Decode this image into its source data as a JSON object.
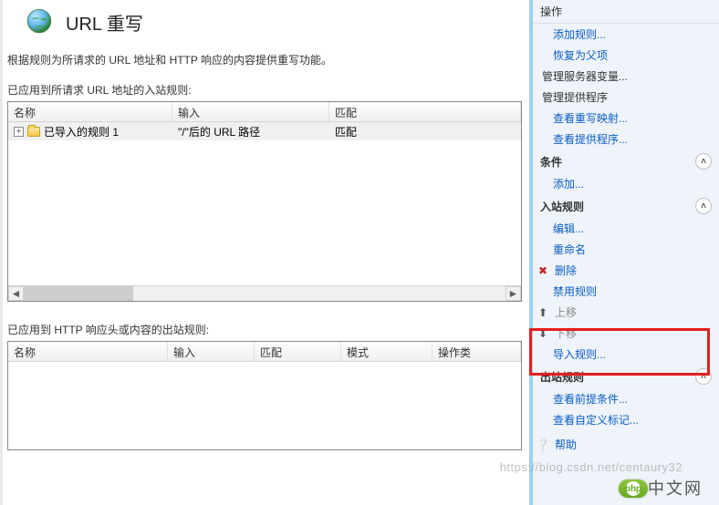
{
  "header": {
    "title": "URL 重写"
  },
  "description": "根据规则为所请求的 URL 地址和 HTTP 响应的内容提供重写功能。",
  "inbound": {
    "label": "已应用到所请求 URL 地址的入站规则:",
    "columns": {
      "name": "名称",
      "input": "输入",
      "match": "匹配"
    },
    "rows": [
      {
        "name": "已导入的规则 1",
        "input": "\"/\"后的 URL 路径",
        "match": "匹配"
      }
    ]
  },
  "outbound": {
    "label": "已应用到 HTTP 响应头或内容的出站规则:",
    "columns": {
      "name": "名称",
      "input": "输入",
      "match": "匹配",
      "mode": "模式",
      "optype": "操作类"
    }
  },
  "sidebar": {
    "title": "操作",
    "actions": {
      "add_rule": "添加规则...",
      "revert_parent": "恢复为父项",
      "manage_server_vars": "管理服务器变量...",
      "manage_providers": "管理提供程序",
      "view_rewrite_maps": "查看重写映射...",
      "view_providers": "查看提供程序..."
    },
    "conditions": {
      "head": "条件",
      "add": "添加..."
    },
    "inbound_rules": {
      "head": "入站规则",
      "edit": "编辑...",
      "rename": "重命名",
      "delete": "删除",
      "disable": "禁用规则",
      "move_up": "上移",
      "move_down": "下移",
      "import": "导入规则..."
    },
    "outbound_rules": {
      "head": "出站规则",
      "view_preconditions": "查看前提条件...",
      "view_custom_tags": "查看自定义标记..."
    },
    "help": "帮助"
  },
  "logo": {
    "php": "php",
    "site": "中文网"
  },
  "watermark": "https://blog.csdn.net/centaury32"
}
